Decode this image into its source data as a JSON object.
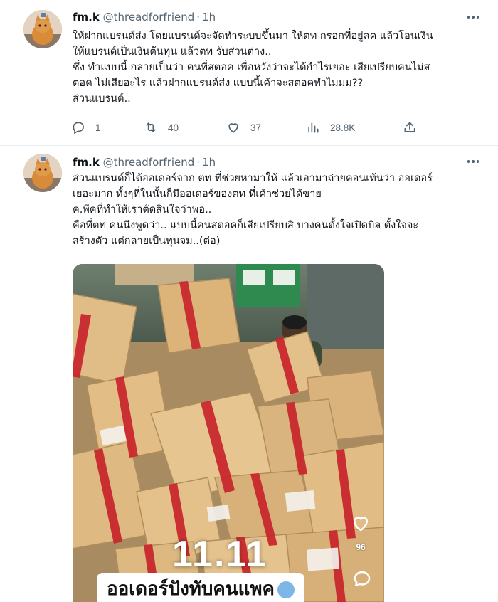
{
  "tweets": [
    {
      "name": "fm.k",
      "handle": "@threadforfriend",
      "time": "1h",
      "lines": [
        "ให้ฝากแบรนด์ส่ง โดยแบรนด์จะจัดทำระบบขึ้นมา ให้ตท กรอกที่อยู่ลค แล้วโอนเงิน",
        "ให้แบรนด์เป็นเงินต้นทุน แล้วตท รับส่วนต่าง..",
        "ซึ่ง ทำแบบนี้ กลายเป็นว่า คนที่สตอค  เพื่อหวังว่าจะได้กำไรเยอะ เสียเปรียบคนไม่ส",
        "ตอค ไม่เสียอะไร แล้วฝากแบรนด์ส่ง แบบนี้เค้าจะสตอคทำไมมม??",
        "ส่วนแบรนด์.."
      ],
      "actions": {
        "replies": "1",
        "retweets": "40",
        "likes": "37",
        "views": "28.8K"
      }
    },
    {
      "name": "fm.k",
      "handle": "@threadforfriend",
      "time": "1h",
      "lines": [
        "ส่วนแบรนด์ก็ได้ออเดอร์จาก ตท ที่ช่วยหามาให้ แล้วเอามาถ่ายคอนเท้นว่า ออเดอร์",
        "เยอะมาก ทั้งๆที่ในนั้นก็มีออเดอร์ของตท ที่เค้าช่วยได้ขาย",
        "ค.พีคที่ทำให้เราตัดสินใจว่าพอ..",
        "คือที่ตท คนนึงพูดว่า.. แบบนี้คนสตอคก็เสียเปรียบสิ บางคนตั้งใจเปิดบิล ตั้งใจจะ",
        "สร้างตัว แต่กลายเป็นทุนจม..(ต่อ)"
      ],
      "media": {
        "date_text": "11.11",
        "caption": "ออเดอร์ปังทับคนแพค",
        "like_count": "96"
      }
    }
  ],
  "colors": {
    "text": "#0f1419",
    "muted": "#536471",
    "divider": "#e6ecf0",
    "box": "#d9b27c",
    "tape": "#c8242b"
  }
}
